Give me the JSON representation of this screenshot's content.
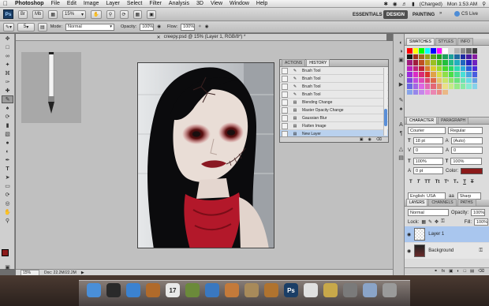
{
  "menubar": {
    "app": "Photoshop",
    "items": [
      "File",
      "Edit",
      "Image",
      "Layer",
      "Select",
      "Filter",
      "Analysis",
      "3D",
      "View",
      "Window",
      "Help"
    ],
    "status": {
      "battery": "(Charged)",
      "clock": "Mon 1:53 AM"
    }
  },
  "appbar": {
    "zoom": "15%",
    "workspaces": [
      "ESSENTIALS",
      "DESIGN",
      "PAINTING"
    ],
    "active_workspace": "DESIGN",
    "cs_live": "CS Live"
  },
  "options": {
    "brush_size": "5",
    "mode_label": "Mode:",
    "mode_value": "Normal",
    "opacity_label": "Opacity:",
    "opacity_value": "100%",
    "flow_label": "Flow:",
    "flow_value": "100%"
  },
  "document": {
    "tab_title": "creepy.psd @ 15% (Layer 1, RGB/8*) *"
  },
  "history": {
    "tabs": [
      "ACTIONS",
      "HISTORY"
    ],
    "active_tab": "HISTORY",
    "items": [
      {
        "label": "Brush Tool",
        "icon": "brush-icon"
      },
      {
        "label": "Brush Tool",
        "icon": "brush-icon"
      },
      {
        "label": "Brush Tool",
        "icon": "brush-icon"
      },
      {
        "label": "Brush Tool",
        "icon": "brush-icon"
      },
      {
        "label": "Blending Change",
        "icon": "layer-icon"
      },
      {
        "label": "Master Opacity Change",
        "icon": "layer-icon"
      },
      {
        "label": "Gaussian Blur",
        "icon": "layer-icon"
      },
      {
        "label": "Flatten Image",
        "icon": "layer-icon"
      },
      {
        "label": "New Layer",
        "icon": "layer-icon",
        "selected": true
      }
    ]
  },
  "statusbar": {
    "zoom": "15%",
    "doc": "Doc: 22.2M/22.2M"
  },
  "swatches": {
    "tabs": [
      "SWATCHES",
      "STYLES",
      "INFO"
    ],
    "active_tab": "SWATCHES",
    "colors": [
      "#ff0000",
      "#ffff00",
      "#00ff00",
      "#00ffff",
      "#0000ff",
      "#ff00ff",
      "#ffffff",
      "#d9d9d9",
      "#b3b3b3",
      "#8c8c8c",
      "#666666",
      "#404040",
      "#1a1a1a",
      "#000000"
    ]
  },
  "character": {
    "tabs": [
      "CHARACTER",
      "PARAGRAPH"
    ],
    "active_tab": "CHARACTER",
    "font_family": "Courier",
    "font_style": "Regular",
    "size": "18 pt",
    "leading": "(Auto)",
    "kerning": "0",
    "tracking": "0",
    "vscale": "100%",
    "hscale": "100%",
    "baseline": "0 pt",
    "color_label": "Color:",
    "color": "#8b1a1a",
    "language": "English: USA",
    "aa_icon": "aa",
    "antialias": "Sharp"
  },
  "layers": {
    "tabs": [
      "LAYERS",
      "CHANNELS",
      "PATHS"
    ],
    "active_tab": "LAYERS",
    "blend": "Normal",
    "opacity_label": "Opacity:",
    "opacity": "100%",
    "lock_label": "Lock:",
    "fill_label": "Fill:",
    "fill": "100%",
    "items": [
      {
        "name": "Layer 1",
        "selected": true
      },
      {
        "name": "Background",
        "locked": true
      }
    ]
  },
  "dock": {
    "apps": [
      {
        "icon": "finder-icon",
        "color": "#4a8fd8"
      },
      {
        "icon": "dashboard-icon",
        "color": "#2a2a2a"
      },
      {
        "icon": "safari-icon",
        "color": "#3b82d0"
      },
      {
        "icon": "mail-icon",
        "color": "#b06a2a"
      },
      {
        "icon": "ical-icon",
        "color": "#e9e9e9",
        "label": "17"
      },
      {
        "icon": "growl-icon",
        "color": "#6b8a3a"
      },
      {
        "icon": "itunes-icon",
        "color": "#3a78c0"
      },
      {
        "icon": "preview-icon",
        "color": "#c47a3a"
      },
      {
        "icon": "photos-icon",
        "color": "#a88a5a"
      },
      {
        "icon": "guitar-icon",
        "color": "#b0732f"
      },
      {
        "icon": "ps-icon",
        "color": "#1b3e66",
        "label": "Ps"
      },
      {
        "icon": "doc-icon",
        "color": "#e0e0e0"
      },
      {
        "icon": "flowers-icon",
        "color": "#c8a84a"
      },
      {
        "icon": "dvd-icon",
        "color": "#7a7a7a"
      },
      {
        "icon": "folder-icon",
        "color": "#8aa4c8"
      },
      {
        "icon": "trash-icon",
        "color": "#9a9a9a"
      }
    ]
  }
}
